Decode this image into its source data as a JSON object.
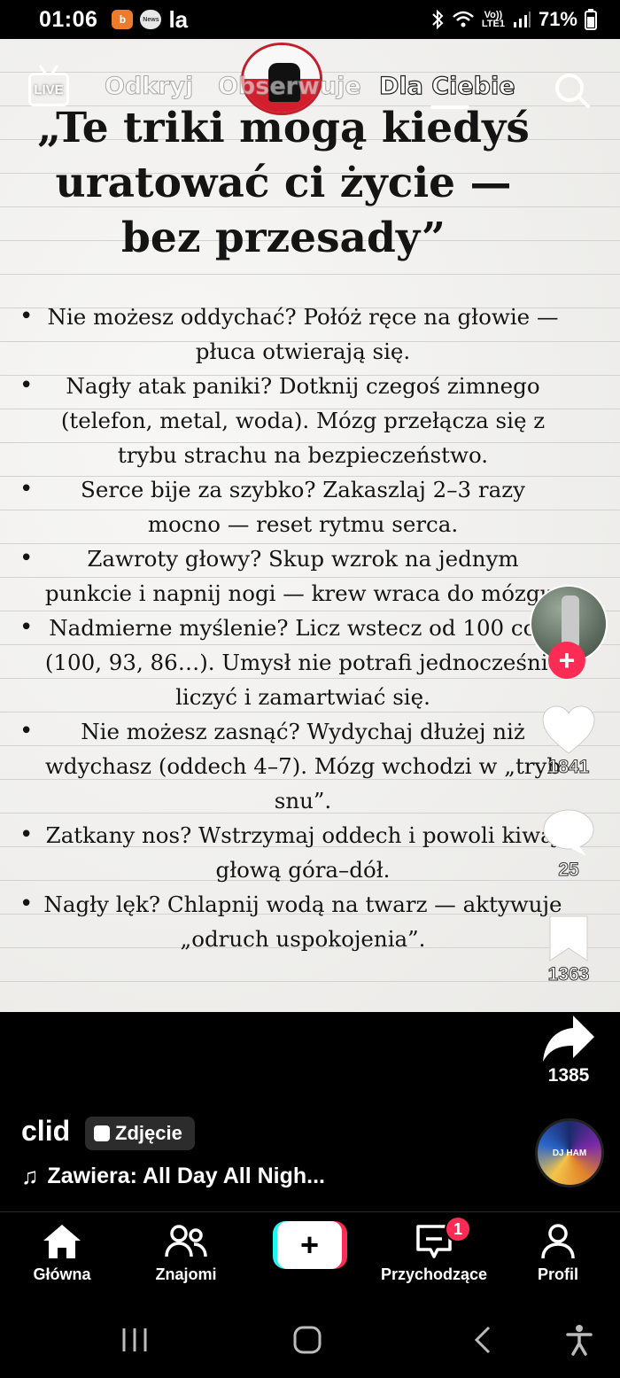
{
  "status_bar": {
    "time": "01:06",
    "app_badge_1": "b",
    "app_badge_2": "News",
    "app_badge_3": "la",
    "network_top": "Vo))",
    "network_bottom": "LTE1",
    "battery": "71%"
  },
  "top_nav": {
    "live_label": "LIVE",
    "tabs": [
      {
        "label": "Odkryj",
        "active": false
      },
      {
        "label": "Obserwuje",
        "active": false
      },
      {
        "label": "Dla Ciebie",
        "active": true
      }
    ]
  },
  "post": {
    "headline": "„Te triki mogą kiedyś uratować ci życie — bez przesady”",
    "tips": [
      "Nie możesz oddychać? Połóż ręce na głowie — płuca otwierają się.",
      "Nagły atak paniki? Dotknij czegoś zimnego (telefon, metal, woda). Mózg przełącza się z trybu strachu na bezpieczeństwo.",
      "Serce bije za szybko? Zakaszlaj 2–3 razy mocno — reset rytmu serca.",
      "Zawroty głowy? Skup wzrok na jednym punkcie i napnij nogi — krew wraca do mózgu.",
      "Nadmierne myślenie? Licz wstecz od 100 co 7 (100, 93, 86…). Umysł nie potrafi jednocześnie liczyć i zamartwiać się.",
      "Nie możesz zasnąć? Wydychaj dłużej niż wdychasz (oddech 4–7). Mózg wchodzi w „tryb snu”.",
      "Zatkany nos? Wstrzymaj oddech i powoli kiwaj głową góra–dół.",
      "Nagły lęk? Chlapnij wodą na twarz — aktywuje „odruch uspokojenia”."
    ]
  },
  "actions": {
    "likes": "1841",
    "comments": "25",
    "saves": "1363",
    "shares": "1385"
  },
  "info": {
    "author": "clid",
    "type_badge": "Zdjęcie",
    "music": "Zawiera: All Day All Nigh...",
    "disc_text": "DJ HAM"
  },
  "bottom_nav": {
    "items": [
      {
        "label": "Główna",
        "icon": "home-icon"
      },
      {
        "label": "Znajomi",
        "icon": "friends-icon"
      },
      {
        "label": "+",
        "icon": "plus-icon"
      },
      {
        "label": "Przychodzące",
        "icon": "inbox-icon"
      },
      {
        "label": "Profil",
        "icon": "profile-icon"
      }
    ],
    "inbox_badge": "1"
  },
  "colors": {
    "accent_pink": "#fe2c55",
    "accent_cyan": "#25f4ee",
    "background": "#000000",
    "paper": "#f0efec"
  }
}
